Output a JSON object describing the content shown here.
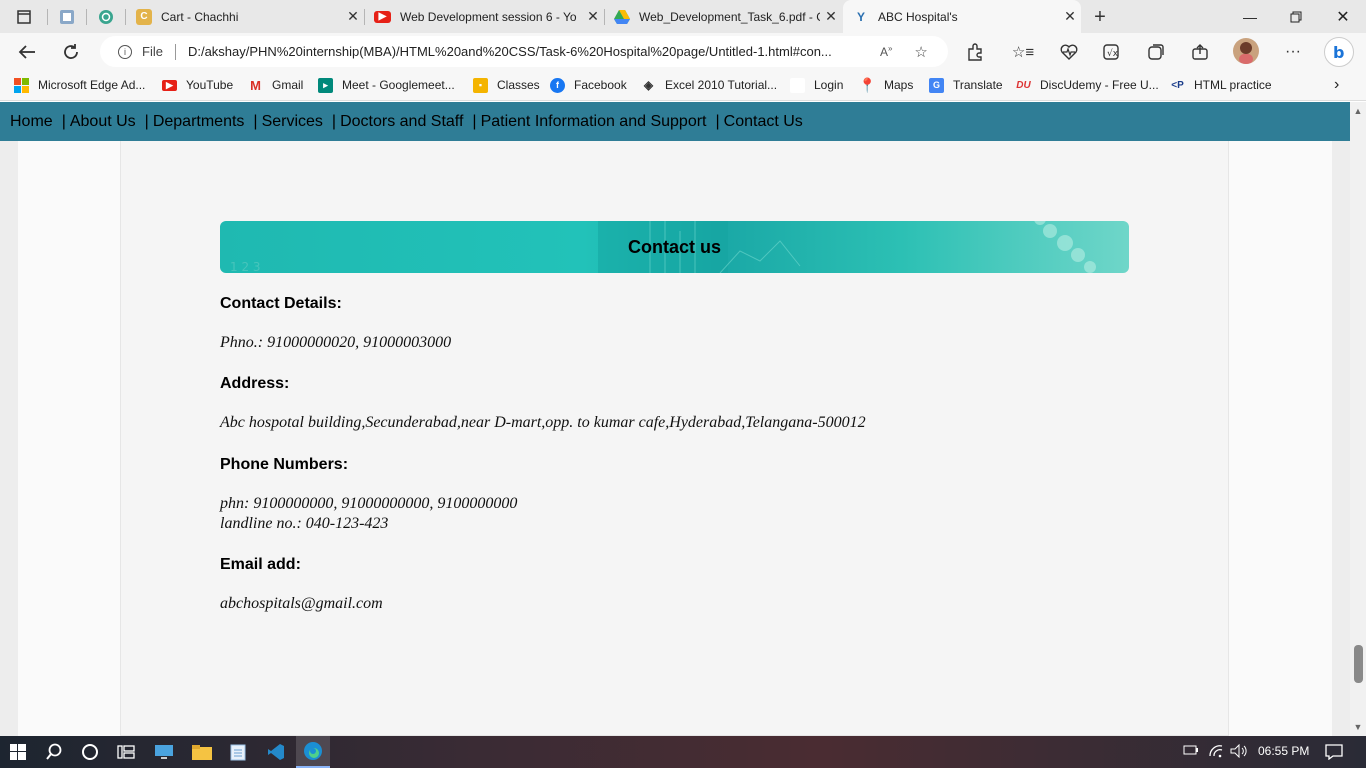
{
  "browser": {
    "tabs": [
      {
        "title": "Cart - Chachhi",
        "favicon": "chachhi-icon",
        "active": false
      },
      {
        "title": "Web Development session 6 - Yo",
        "favicon": "youtube-icon",
        "active": false
      },
      {
        "title": "Web_Development_Task_6.pdf - G",
        "favicon": "google-drive-icon",
        "active": false
      },
      {
        "title": "ABC Hospital's",
        "favicon": "y-icon",
        "active": true
      }
    ],
    "file_label": "File",
    "url": "D:/akshay/PHN%20internship(MBA)/HTML%20and%20CSS/Task-6%20Hospital%20page/Untitled-1.html#con...",
    "favorites": [
      {
        "label": "Microsoft Edge Ad...",
        "icon": "microsoft-icon"
      },
      {
        "label": "YouTube",
        "icon": "youtube-icon"
      },
      {
        "label": "Gmail",
        "icon": "gmail-icon"
      },
      {
        "label": "Meet - Googlemeet...",
        "icon": "meet-icon"
      },
      {
        "label": "Classes",
        "icon": "classroom-icon"
      },
      {
        "label": "Facebook",
        "icon": "facebook-icon"
      },
      {
        "label": "Excel 2010 Tutorial...",
        "icon": "excel-icon"
      },
      {
        "label": "Login",
        "icon": "page-icon"
      },
      {
        "label": "Maps",
        "icon": "maps-icon"
      },
      {
        "label": "Translate",
        "icon": "translate-icon"
      },
      {
        "label": "DiscUdemy - Free U...",
        "icon": "discudemy-icon"
      },
      {
        "label": "HTML practice",
        "icon": "code-icon"
      }
    ]
  },
  "site": {
    "nav": [
      "Home",
      "About Us",
      "Departments",
      "Services",
      "Doctors and Staff",
      "Patient Information and Support",
      "Contact Us"
    ],
    "banner_title": "Contact us",
    "sections": [
      {
        "heading": "Contact Details:",
        "lines": [
          "Phno.: 91000000020, 91000003000"
        ]
      },
      {
        "heading": "Address:",
        "lines": [
          "Abc hospotal building,Secunderabad,near D-mart,opp. to kumar cafe,Hyderabad,Telangana-500012"
        ]
      },
      {
        "heading": "Phone Numbers:",
        "lines": [
          "phn: 9100000000, 91000000000, 9100000000",
          "landline no.: 040-123-423"
        ]
      },
      {
        "heading": "Email add:",
        "lines": [
          "abchospitals@gmail.com"
        ]
      }
    ]
  },
  "taskbar": {
    "time": "06:55 PM"
  },
  "colors": {
    "nav_bg": "#2f7d96",
    "banner": "#22bdb5"
  }
}
